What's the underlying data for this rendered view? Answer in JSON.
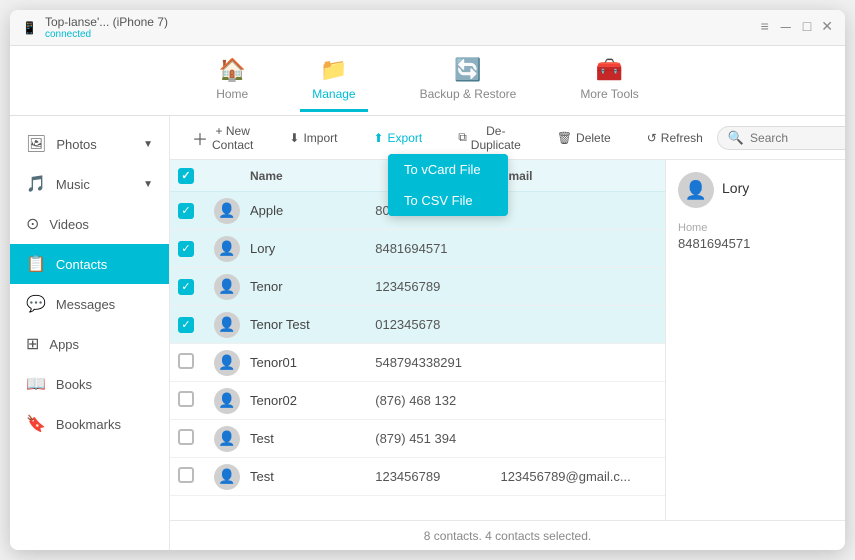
{
  "titlebar": {
    "device": "Top-lanse'... (iPhone 7)",
    "status": "connected",
    "btn_menu": "≡",
    "btn_min": "－",
    "btn_max": "□",
    "btn_close": "✕"
  },
  "navbar": {
    "items": [
      {
        "id": "home",
        "label": "Home",
        "icon": "🏠",
        "active": false
      },
      {
        "id": "manage",
        "label": "Manage",
        "icon": "📁",
        "active": true
      },
      {
        "id": "backup",
        "label": "Backup & Restore",
        "icon": "🔄",
        "active": false
      },
      {
        "id": "more",
        "label": "More Tools",
        "icon": "🧰",
        "active": false
      }
    ]
  },
  "sidebar": {
    "items": [
      {
        "id": "photos",
        "label": "Photos",
        "icon": "🖼",
        "hasArrow": true
      },
      {
        "id": "music",
        "label": "Music",
        "icon": "🎵",
        "hasArrow": true
      },
      {
        "id": "videos",
        "label": "Videos",
        "icon": "⊙",
        "hasArrow": false
      },
      {
        "id": "contacts",
        "label": "Contacts",
        "icon": "📋",
        "active": true,
        "hasArrow": false
      },
      {
        "id": "messages",
        "label": "Messages",
        "icon": "💬",
        "hasArrow": false
      },
      {
        "id": "apps",
        "label": "Apps",
        "icon": "⊞",
        "hasArrow": false
      },
      {
        "id": "books",
        "label": "Books",
        "icon": "📖",
        "hasArrow": false
      },
      {
        "id": "bookmarks",
        "label": "Bookmarks",
        "icon": "🔖",
        "hasArrow": false
      }
    ]
  },
  "toolbar": {
    "new_contact": "+ New Contact",
    "import": "Import",
    "export": "Export",
    "deduplicate": "De-Duplicate",
    "delete": "Delete",
    "refresh": "Refresh",
    "search_placeholder": "Search",
    "export_dropdown": [
      {
        "id": "vcard",
        "label": "To vCard File"
      },
      {
        "id": "csv",
        "label": "To CSV File"
      }
    ]
  },
  "table": {
    "headers": {
      "name": "Name",
      "phone": "",
      "email": "Email"
    },
    "rows": [
      {
        "id": 1,
        "name": "Apple",
        "phone": "800 692 7753",
        "email": "",
        "selected": true
      },
      {
        "id": 2,
        "name": "Lory",
        "phone": "8481694571",
        "email": "",
        "selected": true
      },
      {
        "id": 3,
        "name": "Tenor",
        "phone": "123456789",
        "email": "",
        "selected": true
      },
      {
        "id": 4,
        "name": "Tenor Test",
        "phone": "012345678",
        "email": "",
        "selected": true
      },
      {
        "id": 5,
        "name": "Tenor01",
        "phone": "548794338291",
        "email": "",
        "selected": false
      },
      {
        "id": 6,
        "name": "Tenor02",
        "phone": "(876) 468 132",
        "email": "",
        "selected": false
      },
      {
        "id": 7,
        "name": "Test",
        "phone": "(879) 451 394",
        "email": "",
        "selected": false
      },
      {
        "id": 8,
        "name": "Test",
        "phone": "123456789",
        "email": "123456789@gmail.c...",
        "selected": false
      }
    ]
  },
  "contact_detail": {
    "name": "Lory",
    "phone_label": "Home",
    "phone": "8481694571"
  },
  "status_bar": {
    "text": "8 contacts. 4 contacts selected."
  }
}
